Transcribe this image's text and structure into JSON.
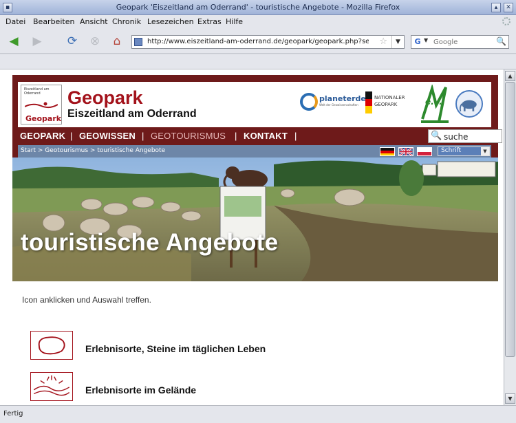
{
  "window": {
    "title": "Geopark 'Eiszeitland am Oderrand' - touristische Angebote - Mozilla Firefox"
  },
  "menu": [
    "Datei",
    "Bearbeiten",
    "Ansicht",
    "Chronik",
    "Lesezeichen",
    "Extras",
    "Hilfe"
  ],
  "toolbar": {
    "url": "http://www.eiszeitland-am-oderrand.de/geopark/geopark.php?seite=",
    "search_placeholder": "Google",
    "search_engine_letter": "G"
  },
  "site": {
    "logo_small_text": "Eiszeitland am Oderrand",
    "logo_label": "Geopark",
    "brand_title": "Geopark",
    "brand_subtitle": "Eiszeitland am Oderrand",
    "partners": {
      "planeterde": "planeterde",
      "planeterde_sub": "Welt der Geowissenschaften",
      "national_line1": "NATIONALER",
      "national_line2": "GEOPARK",
      "ev": "e.V."
    },
    "nav": [
      {
        "label": "GEOPARK",
        "active": false
      },
      {
        "label": "GEOWISSEN",
        "active": false
      },
      {
        "label": "GEOTOURISMUS",
        "active": true
      },
      {
        "label": "KONTAKT",
        "active": false
      }
    ],
    "nav_separator": "|",
    "search_value": "suche",
    "breadcrumb": "Start > Geotourismus > touristische Angebote",
    "font_select": "Schrift",
    "hero_title": "touristische Angebote",
    "intro": "Icon anklicken und Auswahl treffen.",
    "items": [
      {
        "label": "Erlebnisorte, Steine im täglichen Leben",
        "icon": "stone-outline-icon"
      },
      {
        "label": "Erlebnisorte im Gelände",
        "icon": "landscape-sun-icon"
      }
    ]
  },
  "status": "Fertig",
  "colors": {
    "site_red": "#6e1a1a",
    "brand_red": "#a3121b",
    "bread_blue": "#6d86a8"
  }
}
